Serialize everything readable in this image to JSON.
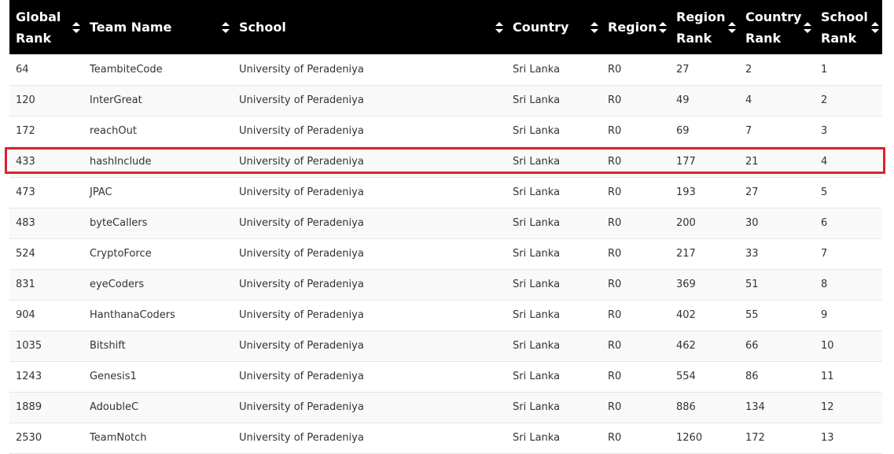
{
  "table": {
    "columns": [
      {
        "label": "Global Rank"
      },
      {
        "label": "Team Name"
      },
      {
        "label": "School"
      },
      {
        "label": "Country"
      },
      {
        "label": "Region"
      },
      {
        "label": "Region Rank"
      },
      {
        "label": "Country Rank"
      },
      {
        "label": "School Rank"
      }
    ],
    "rows": [
      [
        "64",
        "TeambiteCode",
        "University of Peradeniya",
        "Sri Lanka",
        "R0",
        "27",
        "2",
        "1"
      ],
      [
        "120",
        "InterGreat",
        "University of Peradeniya",
        "Sri Lanka",
        "R0",
        "49",
        "4",
        "2"
      ],
      [
        "172",
        "reachOut",
        "University of Peradeniya",
        "Sri Lanka",
        "R0",
        "69",
        "7",
        "3"
      ],
      [
        "433",
        "hashInclude",
        "University of Peradeniya",
        "Sri Lanka",
        "R0",
        "177",
        "21",
        "4"
      ],
      [
        "473",
        "JPAC",
        "University of Peradeniya",
        "Sri Lanka",
        "R0",
        "193",
        "27",
        "5"
      ],
      [
        "483",
        "byteCallers",
        "University of Peradeniya",
        "Sri Lanka",
        "R0",
        "200",
        "30",
        "6"
      ],
      [
        "524",
        "CryptoForce",
        "University of Peradeniya",
        "Sri Lanka",
        "R0",
        "217",
        "33",
        "7"
      ],
      [
        "831",
        "eyeCoders",
        "University of Peradeniya",
        "Sri Lanka",
        "R0",
        "369",
        "51",
        "8"
      ],
      [
        "904",
        "HanthanaCoders",
        "University of Peradeniya",
        "Sri Lanka",
        "R0",
        "402",
        "55",
        "9"
      ],
      [
        "1035",
        "Bitshift",
        "University of Peradeniya",
        "Sri Lanka",
        "R0",
        "462",
        "66",
        "10"
      ],
      [
        "1243",
        "Genesis1",
        "University of Peradeniya",
        "Sri Lanka",
        "R0",
        "554",
        "86",
        "11"
      ],
      [
        "1889",
        "AdoubleC",
        "University of Peradeniya",
        "Sri Lanka",
        "R0",
        "886",
        "134",
        "12"
      ],
      [
        "2530",
        "TeamNotch",
        "University of Peradeniya",
        "Sri Lanka",
        "R0",
        "1260",
        "172",
        "13"
      ]
    ]
  },
  "highlight": {
    "row_index": 3,
    "color": "#d9232e"
  },
  "colors": {
    "header_bg": "#000000",
    "header_text": "#ffffff",
    "row_alt_bg": "#f9f9f9",
    "row_border": "#e6e6e6"
  },
  "icons": {
    "sort": "sort-arrows-icon"
  }
}
